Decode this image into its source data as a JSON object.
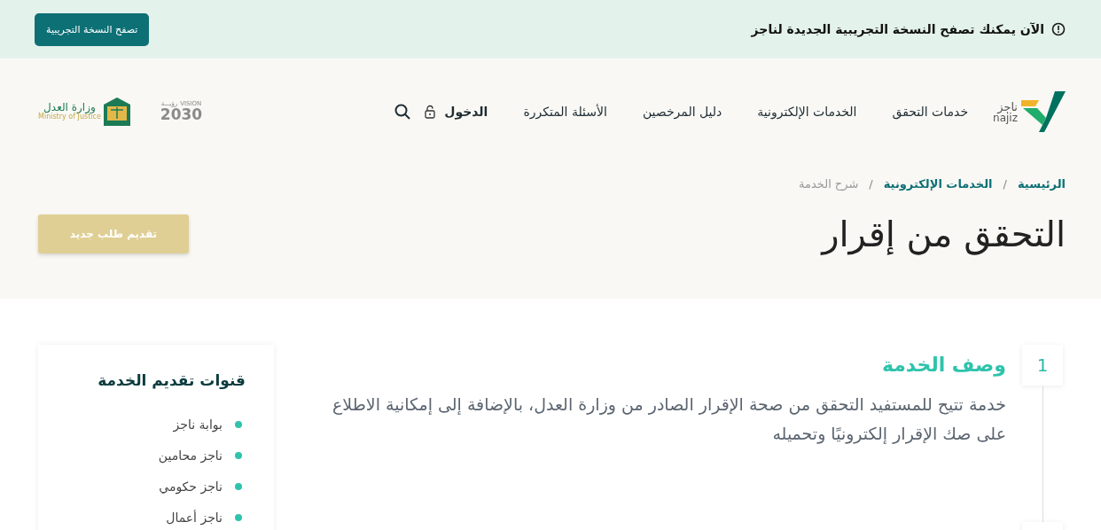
{
  "notice": {
    "text": "الآن يمكنك تصفح النسخة التجريبية الجديدة لناجز",
    "button": "تصفح النسخة التجريبية"
  },
  "header": {
    "logo": {
      "arabic": "ناجز",
      "latin": "najiz"
    },
    "nav": [
      {
        "label": "خدمات التحقق"
      },
      {
        "label": "الخدمات الإلكترونية"
      },
      {
        "label": "دليل المرخصين"
      },
      {
        "label": "الأسئلة المتكررة"
      }
    ],
    "login": "الدخول",
    "vision": {
      "label": "VISION",
      "arabic": "رؤيـــة",
      "year": "2030"
    },
    "ministry": {
      "arabic": "وزارة العدل",
      "english": "Ministry of Justice"
    }
  },
  "breadcrumb_separator": "/",
  "breadcrumb": [
    {
      "label": "الرئيسية",
      "current": false
    },
    {
      "label": "الخدمات الإلكترونية",
      "current": false
    },
    {
      "label": "شرح الخدمة",
      "current": true
    }
  ],
  "title": "التحقق من إقرار",
  "new_request_button": "تقديم طلب جديد",
  "steps": [
    {
      "number": "1",
      "title": "وصف الخدمة",
      "text": "خدمة تتيح للمستفيد التحقق من صحة الإقرار الصادر من وزارة العدل، بالإضافة إلى إمكانية الاطلاع على صك الإقرار إلكترونيًا وتحميله"
    }
  ],
  "channels": {
    "title": "قنوات تقديم الخدمة",
    "items": [
      "بوابة ناجز",
      "ناجز محامين",
      "ناجز حكومي",
      "ناجز أعمال"
    ]
  }
}
